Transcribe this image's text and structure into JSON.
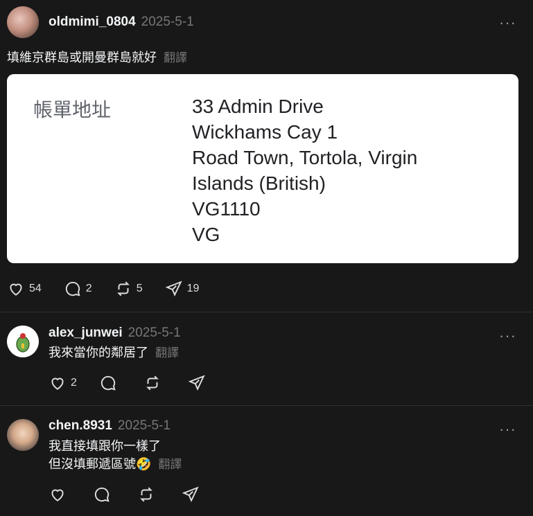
{
  "posts": [
    {
      "username": "oldmimi_0804",
      "date": "2025-5-1",
      "text": "填維京群島或開曼群島就好",
      "translate": "翻譯",
      "card": {
        "label": "帳單地址",
        "address_lines": [
          "33 Admin Drive",
          "Wickhams Cay 1",
          "Road Town, Tortola, Virgin",
          "Islands (British)",
          "VG1110",
          "VG"
        ]
      },
      "likes": "54",
      "comments": "2",
      "reposts": "5",
      "shares": "19"
    },
    {
      "username": "alex_junwei",
      "date": "2025-5-1",
      "text": "我來當你的鄰居了",
      "translate": "翻譯",
      "likes": "2"
    },
    {
      "username": "chen.8931",
      "date": "2025-5-1",
      "text_line1": "我直接填跟你一樣了",
      "text_line2": "但沒填郵遞區號🤣",
      "translate": "翻譯"
    }
  ],
  "icons": {
    "more": "more-icon",
    "like": "heart-icon",
    "comment": "comment-icon",
    "repost": "repost-icon",
    "share": "share-icon"
  }
}
